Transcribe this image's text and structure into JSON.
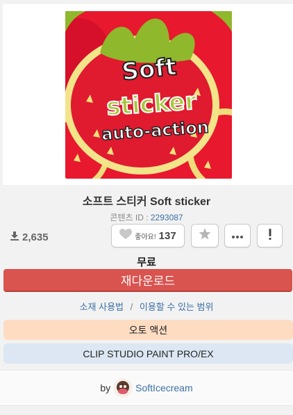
{
  "hero": {
    "line1": "Soft",
    "line2": "sticker",
    "line3": "auto-action"
  },
  "title": "소프트 스티커 Soft sticker",
  "content_id": {
    "label": "콘텐츠 ID :",
    "value": "2293087"
  },
  "stats": {
    "downloads": "2,635",
    "like_label": "좋아요!",
    "like_count": "137"
  },
  "price": "무료",
  "redownload_label": "재다운로드",
  "links": {
    "usage": "소재 사용법",
    "separator": "/",
    "scope": "이용할 수 있는 범위"
  },
  "tags": {
    "category": "오토 액션",
    "software": "CLIP STUDIO PAINT PRO/EX"
  },
  "footer": {
    "by": "by",
    "author": "SoftIcecream"
  },
  "colors": {
    "accent_red": "#d9534f",
    "link_blue": "#3b6fa6",
    "pill_orange": "#fddcc2",
    "pill_blue": "#dce7f3"
  },
  "icons": {
    "download": "download-icon",
    "like": "heart-icon",
    "favorite": "star-icon",
    "more": "ellipsis-icon",
    "report": "exclamation-icon"
  }
}
